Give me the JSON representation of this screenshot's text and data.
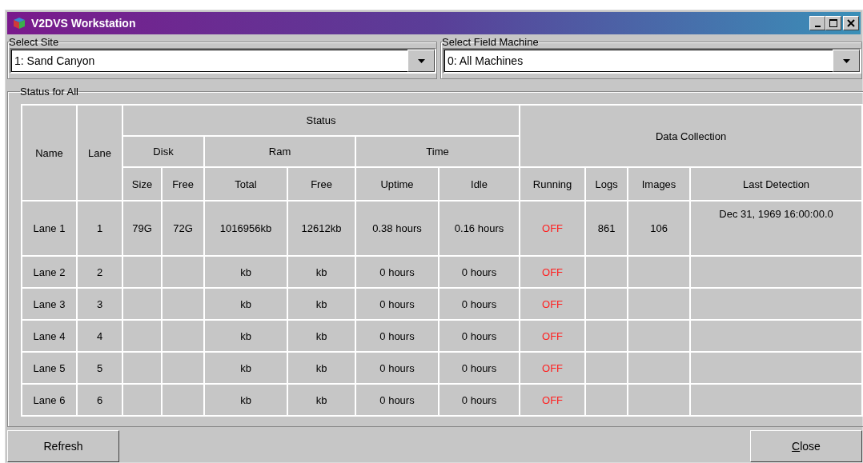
{
  "window": {
    "title": "V2DVS Workstation"
  },
  "site_select": {
    "label": "Select Site",
    "value": "1: Sand Canyon"
  },
  "machine_select": {
    "label": "Select Field Machine",
    "value": "0: All Machines"
  },
  "status_group": {
    "label": "Status for All"
  },
  "table": {
    "header": {
      "name": "Name",
      "lane": "Lane",
      "status": "Status",
      "disk": "Disk",
      "ram": "Ram",
      "time": "Time",
      "data_collection": "Data Collection",
      "columns": [
        "Size",
        "Free",
        "Total",
        "Free",
        "Uptime",
        "Idle",
        "Running",
        "Logs",
        "Images",
        "Last Detection"
      ]
    },
    "rows": [
      {
        "name": "Lane 1",
        "lane": "1",
        "size": "79G",
        "free": "72G",
        "ram_total": "1016956kb",
        "ram_free": "12612kb",
        "uptime": "0.38 hours",
        "idle": "0.16 hours",
        "running": {
          "text": "OFF",
          "on": false
        },
        "logs": "861",
        "images": "106",
        "last_detection": "Dec 31, 1969 16:00:00.0"
      },
      {
        "name": "Lane 2",
        "lane": "2",
        "ram_total": "kb",
        "ram_free": "kb",
        "uptime": "0 hours",
        "idle": "0 hours",
        "running": {
          "text": "OFF",
          "on": false
        }
      },
      {
        "name": "Lane 3",
        "lane": "3",
        "ram_total": "kb",
        "ram_free": "kb",
        "uptime": "0 hours",
        "idle": "0 hours",
        "running": {
          "text": "OFF",
          "on": false
        }
      },
      {
        "name": "Lane 4",
        "lane": "4",
        "ram_total": "kb",
        "ram_free": "kb",
        "uptime": "0 hours",
        "idle": "0 hours",
        "running": {
          "text": "OFF",
          "on": false
        }
      },
      {
        "name": "Lane 5",
        "lane": "5",
        "ram_total": "kb",
        "ram_free": "kb",
        "uptime": "0 hours",
        "idle": "0 hours",
        "running": {
          "text": "OFF",
          "on": false
        }
      },
      {
        "name": "Lane 6",
        "lane": "6",
        "ram_total": "kb",
        "ram_free": "kb",
        "uptime": "0 hours",
        "idle": "0 hours",
        "running": {
          "text": "OFF",
          "on": false
        }
      }
    ]
  },
  "buttons": [
    {
      "label": "Refresh",
      "underline_first": false
    },
    {
      "label": "Close",
      "underline_first": true
    }
  ]
}
